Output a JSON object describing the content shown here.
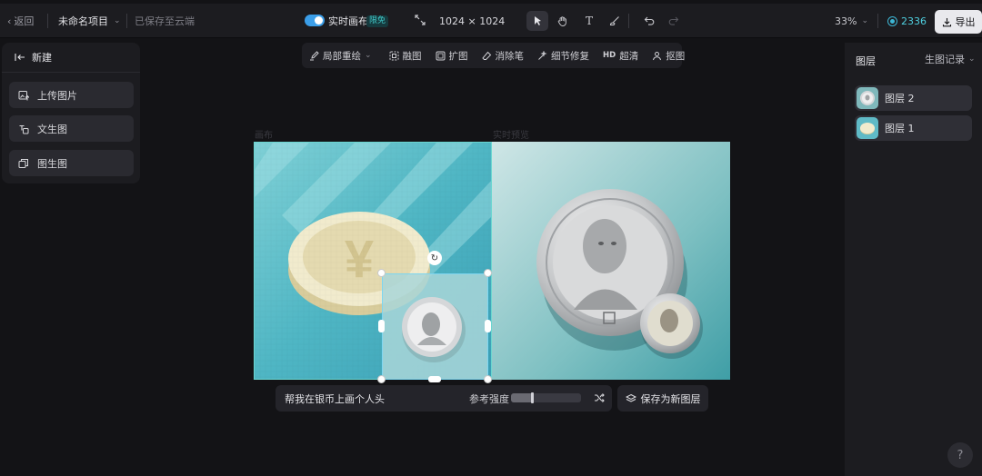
{
  "topbar": {
    "back_label": "返回",
    "project_name": "未命名项目",
    "save_status": "已保存至云端",
    "realtime_label": "实时画布",
    "realtime_badge": "限免",
    "realtime_on": true,
    "canvas_size": "1024 × 1024",
    "zoom": "33%",
    "credits": "2336",
    "export_label": "导出",
    "tools": [
      "select-icon",
      "hand-icon",
      "text-icon",
      "brush-icon",
      "undo-icon",
      "redo-icon"
    ]
  },
  "left_panel": {
    "new_label": "新建",
    "buttons": [
      {
        "label": "上传图片",
        "icon": "upload-image-icon"
      },
      {
        "label": "文生图",
        "icon": "text-to-image-icon"
      },
      {
        "label": "图生图",
        "icon": "image-to-image-icon"
      }
    ]
  },
  "subtoolbar": {
    "items": [
      {
        "label": "局部重绘",
        "icon": "inpaint-icon"
      },
      {
        "label": "融图",
        "icon": "blend-icon"
      },
      {
        "label": "扩图",
        "icon": "expand-icon"
      },
      {
        "label": "消除笔",
        "icon": "eraser-icon"
      },
      {
        "label": "细节修复",
        "icon": "detail-fix-icon"
      },
      {
        "label": "超清",
        "icon": "hd-icon",
        "icon_text": "HD"
      },
      {
        "label": "抠图",
        "icon": "cutout-icon"
      }
    ]
  },
  "canvas": {
    "canvas_label": "画布",
    "preview_label": "实时预览"
  },
  "prompt_bar": {
    "prompt_text": "帮我在银币上画个人头",
    "ref_strength_label": "参考强度",
    "ref_strength": 0.3,
    "save_new_layer_label": "保存为新图层"
  },
  "right_panel": {
    "title": "图层",
    "history_label": "生图记录",
    "layers": [
      {
        "name": "图层 2"
      },
      {
        "name": "图层 1"
      }
    ]
  },
  "help_label": "?",
  "colors": {
    "accent": "#3b9ee8",
    "credits": "#4fd0e0",
    "selection": "#7ed6f0"
  }
}
